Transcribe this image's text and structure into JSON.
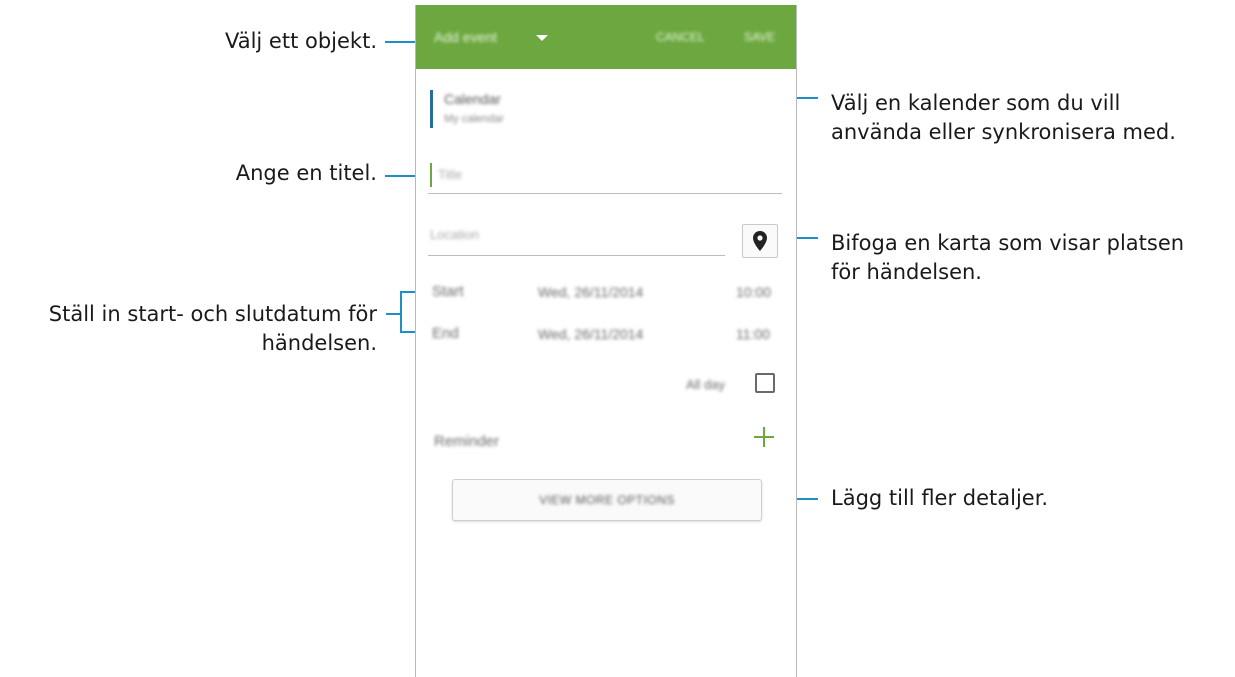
{
  "callouts": {
    "select_item": "Välj ett objekt.",
    "choose_calendar_line1": "Välj en kalender som du vill",
    "choose_calendar_line2": "använda eller synkronisera med.",
    "enter_title": "Ange en titel.",
    "attach_map_line1": "Bifoga en karta som visar platsen",
    "attach_map_line2": "för händelsen.",
    "set_dates_line1": "Ställ in start- och slutdatum för",
    "set_dates_line2": "händelsen.",
    "add_details": "Lägg till fler detaljer."
  },
  "appbar": {
    "title": "Add event",
    "cancel_label": "CANCEL",
    "save_label": "SAVE",
    "color": "#6ca83f"
  },
  "form": {
    "calendar_label": "Calendar",
    "calendar_value": "My calendar",
    "title_placeholder": "Title",
    "location_placeholder": "Location",
    "location_icon": "map-pin-icon",
    "start_label": "Start",
    "start_date": "Wed, 26/11/2014",
    "start_time": "10:00",
    "end_label": "End",
    "end_date": "Wed, 26/11/2014",
    "end_time": "11:00",
    "all_day_label": "All day",
    "all_day_checked": false,
    "reminder_label": "Reminder",
    "more_options_label": "VIEW MORE OPTIONS"
  },
  "colors": {
    "accent_green": "#6ca83f",
    "callout_line": "#1f8fc8",
    "calendar_indicator": "#2a6c9e"
  }
}
